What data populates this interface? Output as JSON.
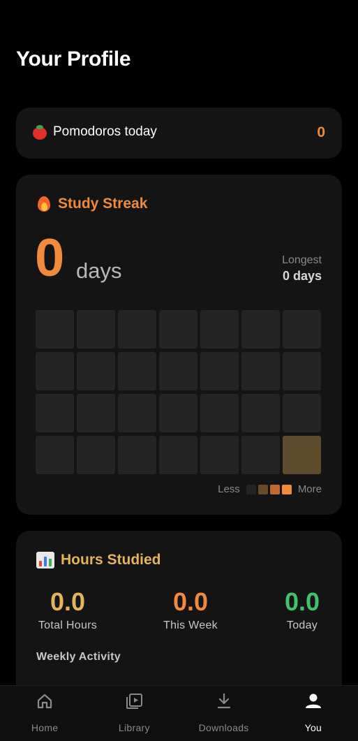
{
  "header": {
    "title": "Your Profile"
  },
  "pomodoro": {
    "label": "Pomodoros today",
    "count": "0",
    "icon": "tomato-icon"
  },
  "streak": {
    "title": "Study Streak",
    "icon": "flame-icon",
    "current_value": "0",
    "unit": "days",
    "longest_label": "Longest",
    "longest_value": "0 days",
    "heatmap": {
      "rows": 4,
      "cols": 7,
      "levels": [
        0,
        0,
        0,
        0,
        0,
        0,
        0,
        0,
        0,
        0,
        0,
        0,
        0,
        0,
        0,
        0,
        0,
        0,
        0,
        0,
        0,
        0,
        0,
        0,
        0,
        0,
        0,
        1
      ]
    },
    "legend": {
      "less": "Less",
      "more": "More",
      "colors": [
        "#242424",
        "#6a4a2a",
        "#c06a30",
        "#f08a3c"
      ]
    }
  },
  "hours": {
    "title": "Hours Studied",
    "icon": "bar-chart-icon",
    "stats": [
      {
        "value": "0.0",
        "label": "Total Hours",
        "color": "#e6b35a"
      },
      {
        "value": "0.0",
        "label": "This Week",
        "color": "#f08a3c"
      },
      {
        "value": "0.0",
        "label": "Today",
        "color": "#3fc46a"
      }
    ],
    "weekly_label": "Weekly Activity"
  },
  "nav": {
    "items": [
      {
        "label": "Home",
        "icon": "home-icon",
        "active": false
      },
      {
        "label": "Library",
        "icon": "library-icon",
        "active": false
      },
      {
        "label": "Downloads",
        "icon": "download-icon",
        "active": false
      },
      {
        "label": "You",
        "icon": "person-icon",
        "active": true
      }
    ]
  },
  "colors": {
    "accent_orange": "#f08a3c",
    "accent_gold": "#e6b35a",
    "accent_green": "#3fc46a",
    "card_bg": "#141414",
    "page_bg": "#000000"
  }
}
